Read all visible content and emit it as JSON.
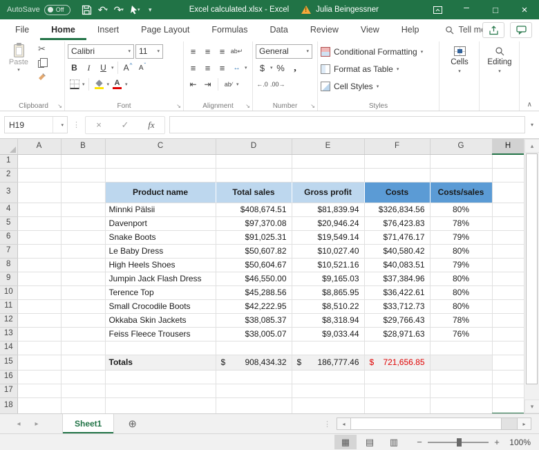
{
  "titlebar": {
    "autosave_label": "AutoSave",
    "autosave_state": "Off",
    "title": "Excel calculated.xlsx - Excel",
    "user": "Julia Beingessner"
  },
  "tabs": {
    "items": [
      "File",
      "Home",
      "Insert",
      "Page Layout",
      "Formulas",
      "Data",
      "Review",
      "View",
      "Help"
    ],
    "active": "Home",
    "tell_me": "Tell me"
  },
  "ribbon": {
    "clipboard": {
      "label": "Clipboard",
      "paste": "Paste"
    },
    "font": {
      "label": "Font",
      "family": "Calibri",
      "size": "11"
    },
    "alignment": {
      "label": "Alignment"
    },
    "number": {
      "label": "Number",
      "format": "General"
    },
    "styles": {
      "label": "Styles",
      "conditional_formatting": "Conditional Formatting",
      "format_as_table": "Format as Table",
      "cell_styles": "Cell Styles"
    },
    "cells": {
      "label": "Cells"
    },
    "editing": {
      "label": "Editing"
    }
  },
  "formula_bar": {
    "name_box": "H19",
    "formula": ""
  },
  "grid": {
    "columns": [
      "A",
      "B",
      "C",
      "D",
      "E",
      "F",
      "G",
      "H"
    ],
    "selected_column": "H",
    "selected_cell": "H19",
    "row_numbers": [
      "1",
      "2",
      "3",
      "4",
      "5",
      "6",
      "7",
      "8",
      "9",
      "10",
      "11",
      "12",
      "13",
      "14",
      "15",
      "16",
      "17",
      "18"
    ]
  },
  "table": {
    "headers": [
      "Product name",
      "Total sales",
      "Gross profit",
      "Costs",
      "Costs/sales"
    ],
    "rows": [
      {
        "name": "Minnki Pälsii",
        "sales": "$408,674.51",
        "profit": "$81,839.94",
        "costs": "$326,834.56",
        "ratio": "80%"
      },
      {
        "name": "Davenport",
        "sales": "$97,370.08",
        "profit": "$20,946.24",
        "costs": "$76,423.83",
        "ratio": "78%"
      },
      {
        "name": "Snake Boots",
        "sales": "$91,025.31",
        "profit": "$19,549.14",
        "costs": "$71,476.17",
        "ratio": "79%"
      },
      {
        "name": "Le Baby Dress",
        "sales": "$50,607.82",
        "profit": "$10,027.40",
        "costs": "$40,580.42",
        "ratio": "80%"
      },
      {
        "name": "High Heels Shoes",
        "sales": "$50,604.67",
        "profit": "$10,521.16",
        "costs": "$40,083.51",
        "ratio": "79%"
      },
      {
        "name": "Jumpin Jack Flash Dress",
        "sales": "$46,550.00",
        "profit": "$9,165.03",
        "costs": "$37,384.96",
        "ratio": "80%"
      },
      {
        "name": "Terence Top",
        "sales": "$45,288.56",
        "profit": "$8,865.95",
        "costs": "$36,422.61",
        "ratio": "80%"
      },
      {
        "name": "Small Crocodile Boots",
        "sales": "$42,222.95",
        "profit": "$8,510.22",
        "costs": "$33,712.73",
        "ratio": "80%"
      },
      {
        "name": "Okkaba Skin Jackets",
        "sales": "$38,085.37",
        "profit": "$8,318.94",
        "costs": "$29,766.43",
        "ratio": "78%"
      },
      {
        "name": "Feiss Fleece Trousers",
        "sales": "$38,005.07",
        "profit": "$9,033.44",
        "costs": "$28,971.63",
        "ratio": "76%"
      }
    ],
    "totals": {
      "label": "Totals",
      "currency": "$",
      "sales": "908,434.32",
      "profit": "186,777.46",
      "costs": "721,656.85"
    }
  },
  "sheet_bar": {
    "tabs": [
      {
        "label": "Sheet1",
        "active": true
      }
    ]
  },
  "status_bar": {
    "zoom_level": "100%"
  },
  "colors": {
    "title_green": "#217346",
    "header_light_blue": "#BDD7EE",
    "header_dark_blue": "#5B9BD5",
    "costs_total_red": "#E00000",
    "selection_green": "#217346"
  },
  "g": {
    "dd": "▾",
    "up": "▴",
    "dn": "▾",
    "lt": "◂",
    "rt": "▸",
    "x": "×",
    "chk": "✓",
    "fx": "fx",
    "dots": "⋮",
    "plus": "⊕",
    "col": "∧",
    "v1": "▦",
    "v2": "▤",
    "v3": "▥",
    "zm": "−",
    "zp": "+",
    "pct": "%",
    "com": ",",
    "dol": "$",
    "b": "B",
    "i": "I",
    "u": "U",
    "A": "A",
    "cu": "^",
    "cd": "ˇ",
    "al": "≡",
    "wrap": "ab↵",
    "mrg": "↔",
    "orient": "ab∕",
    "ind1": "⇤",
    "ind2": "⇥",
    "d1": "←.0",
    "d2": ".00→",
    "cut": "✂",
    "undo": "↶",
    "redo": "↷",
    "lau": "↘",
    "ex": "!",
    "min": "–",
    "max": "□"
  }
}
